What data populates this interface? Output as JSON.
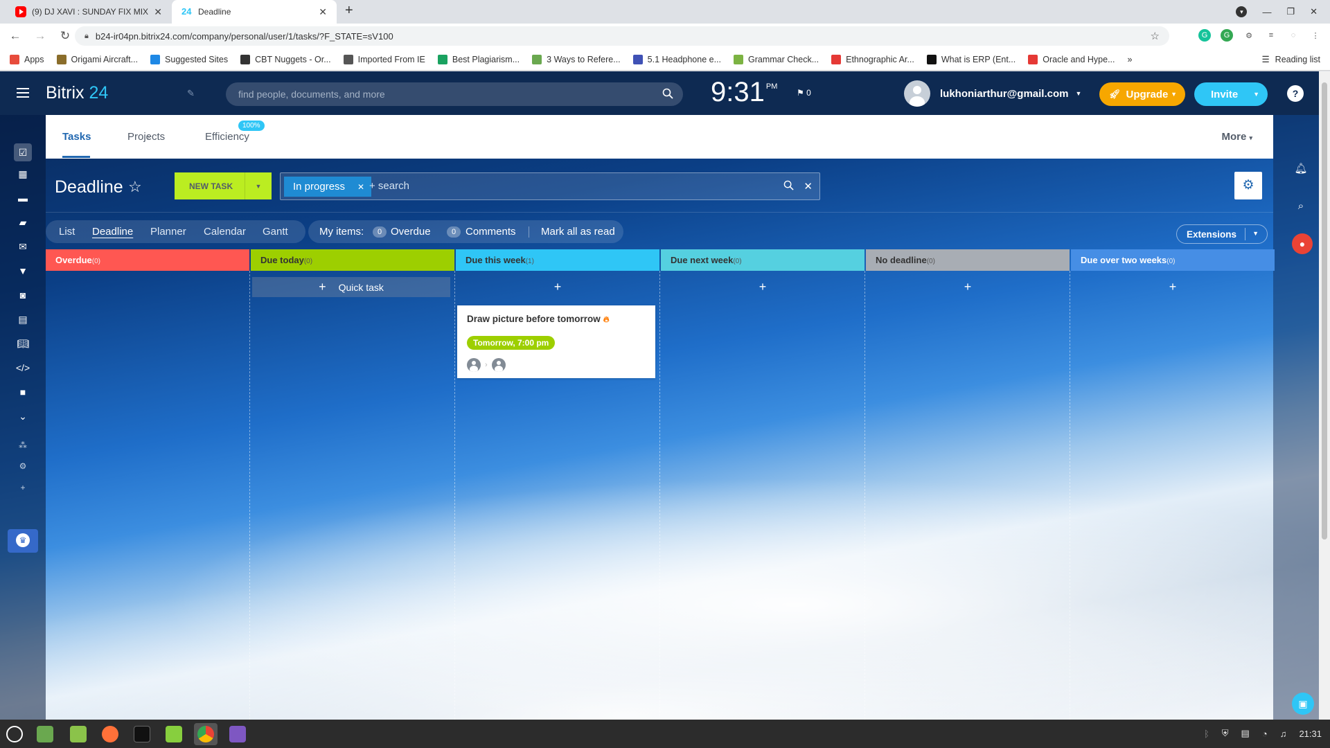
{
  "browser": {
    "tabs": [
      {
        "title": "(9) DJ XAVI : SUNDAY FIX MIX",
        "active": false
      },
      {
        "title": "Deadline",
        "favicon_text": "24",
        "active": true
      }
    ],
    "url": "b24-ir04pn.bitrix24.com/company/personal/user/1/tasks/?F_STATE=sV100",
    "bookmarks": [
      {
        "label": "Apps",
        "color": "#e74c3c"
      },
      {
        "label": "Origami Aircraft...",
        "color": "#8a6d2b"
      },
      {
        "label": "Suggested Sites",
        "color": "#1e88e5"
      },
      {
        "label": "CBT Nuggets - Or...",
        "color": "#333333"
      },
      {
        "label": "Imported From IE",
        "color": "#555555"
      },
      {
        "label": "Best Plagiarism...",
        "color": "#1aa260"
      },
      {
        "label": "3 Ways to Refere...",
        "color": "#6aa84f"
      },
      {
        "label": "5.1 Headphone e...",
        "color": "#3f51b5"
      },
      {
        "label": "Grammar Check...",
        "color": "#7cb342"
      },
      {
        "label": "Ethnographic Ar...",
        "color": "#e53935"
      },
      {
        "label": "What is ERP (Ent...",
        "color": "#111111"
      },
      {
        "label": "Oracle and Hype...",
        "color": "#e53935"
      }
    ],
    "reading_list": "Reading list"
  },
  "header": {
    "logo_text": "Bitrix",
    "logo_num": "24",
    "search_placeholder": "find people, documents, and more",
    "time": "9:31",
    "ampm": "PM",
    "flag_count": "0",
    "user_email": "lukhoniarthur@gmail.com",
    "upgrade_label": "Upgrade",
    "invite_label": "Invite",
    "help_label": "?"
  },
  "nav": {
    "tasks": "Tasks",
    "projects": "Projects",
    "efficiency": "Efficiency",
    "efficiency_badge": "100%",
    "more": "More"
  },
  "toolbar": {
    "title": "Deadline",
    "new_task": "NEW TASK",
    "filter_chip": "In progress",
    "search_placeholder": "+ search"
  },
  "views": {
    "items": [
      "List",
      "Deadline",
      "Planner",
      "Calendar",
      "Gantt"
    ],
    "active": "Deadline",
    "my_items_label": "My items:",
    "overdue_count": "0",
    "overdue_label": "Overdue",
    "comments_count": "0",
    "comments_label": "Comments",
    "mark_read": "Mark all as read",
    "extensions": "Extensions"
  },
  "columns": [
    {
      "title": "Overdue",
      "count": "(0)",
      "color": "#ff5752",
      "text_color": "#ffffff"
    },
    {
      "title": "Due today",
      "count": "(0)",
      "color": "#9dcf00",
      "text_color": "#333333",
      "quick_task": "Quick task"
    },
    {
      "title": "Due this week",
      "count": "(1)",
      "color": "#2fc6f6",
      "text_color": "#333333"
    },
    {
      "title": "Due next week",
      "count": "(0)",
      "color": "#55d0e0",
      "text_color": "#333333"
    },
    {
      "title": "No deadline",
      "count": "(0)",
      "color": "#a8adb4",
      "text_color": "#333333"
    },
    {
      "title": "Due over two weeks",
      "count": "(0)",
      "color": "#468ee5",
      "text_color": "#ffffff"
    }
  ],
  "task_card": {
    "title": "Draw picture before tomorrow",
    "deadline": "Tomorrow, 7:00 pm"
  },
  "taskbar": {
    "time": "21:31"
  }
}
